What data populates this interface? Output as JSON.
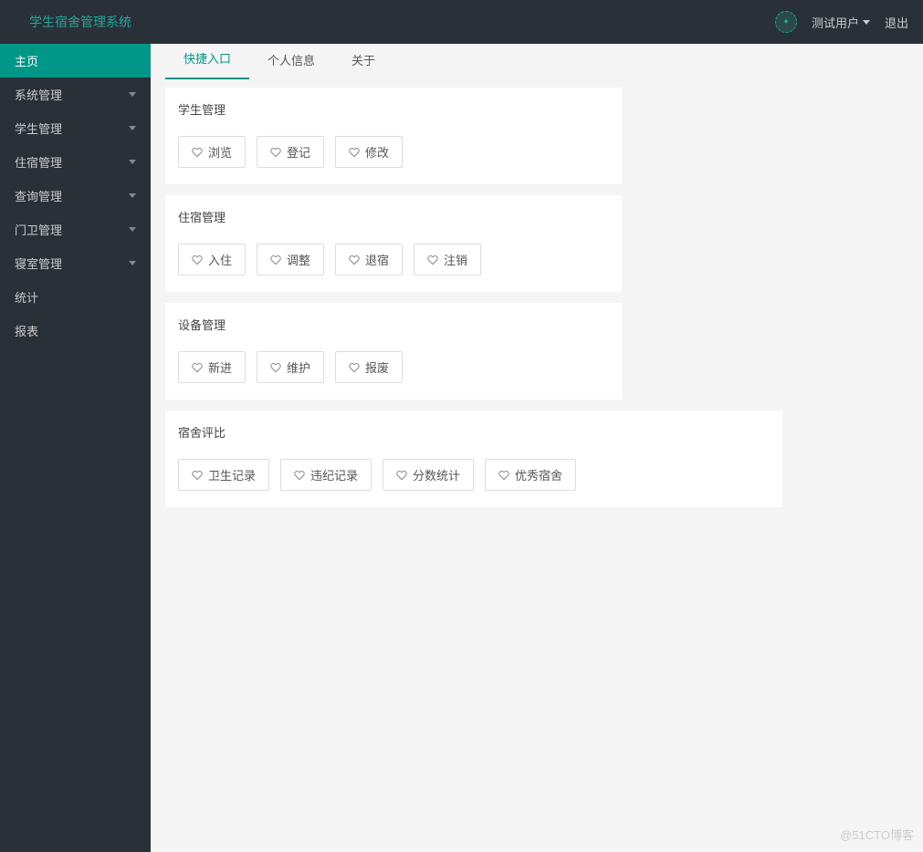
{
  "header": {
    "title": "学生宿舍管理系统",
    "user": "测试用户",
    "logout": "退出"
  },
  "sidebar": {
    "items": [
      {
        "label": "主页",
        "active": true,
        "expandable": false
      },
      {
        "label": "系统管理",
        "active": false,
        "expandable": true
      },
      {
        "label": "学生管理",
        "active": false,
        "expandable": true
      },
      {
        "label": "住宿管理",
        "active": false,
        "expandable": true
      },
      {
        "label": "查询管理",
        "active": false,
        "expandable": true
      },
      {
        "label": "门卫管理",
        "active": false,
        "expandable": true
      },
      {
        "label": "寝室管理",
        "active": false,
        "expandable": true
      },
      {
        "label": "统计",
        "active": false,
        "expandable": false
      },
      {
        "label": "报表",
        "active": false,
        "expandable": false
      }
    ]
  },
  "tabs": [
    {
      "label": "快捷入口",
      "active": true
    },
    {
      "label": "个人信息",
      "active": false
    },
    {
      "label": "关于",
      "active": false
    }
  ],
  "panels": [
    {
      "title": "学生管理",
      "buttons": [
        "浏览",
        "登记",
        "修改"
      ]
    },
    {
      "title": "住宿管理",
      "buttons": [
        "入住",
        "调整",
        "退宿",
        "注销"
      ]
    },
    {
      "title": "设备管理",
      "buttons": [
        "新进",
        "维护",
        "报废"
      ]
    },
    {
      "title": "宿舍评比",
      "buttons": [
        "卫生记录",
        "违纪记录",
        "分数统计",
        "优秀宿舍"
      ]
    }
  ],
  "watermark": "@51CTO博客"
}
